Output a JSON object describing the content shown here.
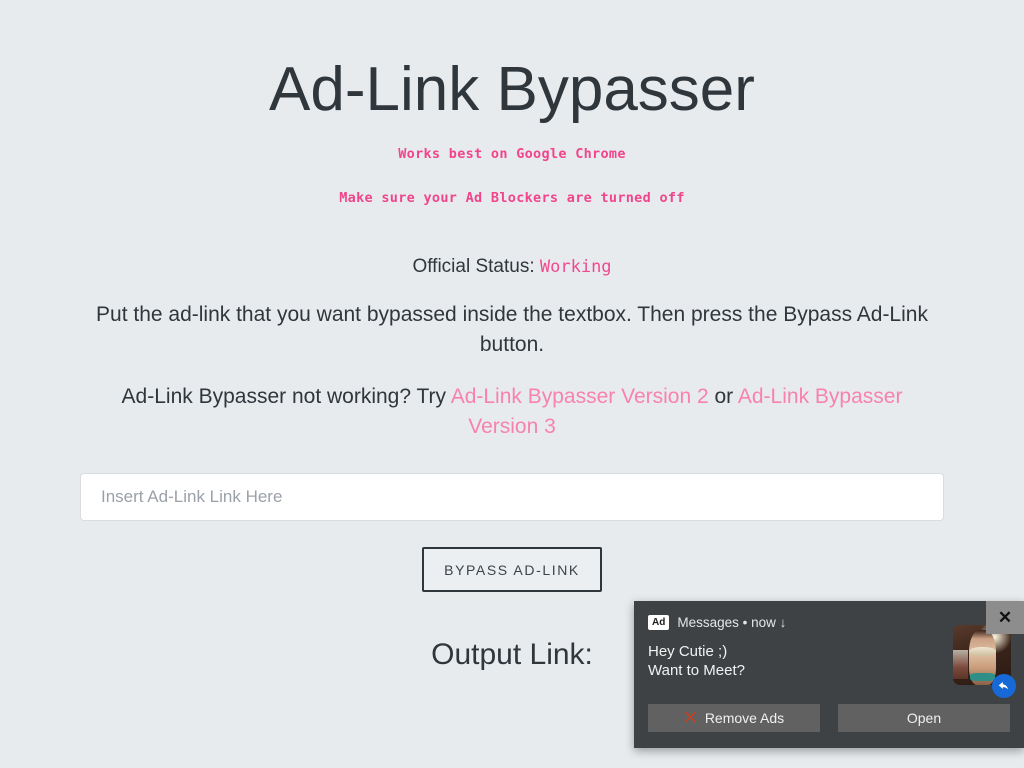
{
  "page": {
    "background_color": "#e8ebee",
    "title": "Ad-Link Bypasser",
    "notes": {
      "chrome": "Works best on Google Chrome",
      "adblock": "Make sure your Ad Blockers are turned off"
    },
    "status": {
      "label": "Official Status:",
      "value": "Working",
      "value_color": "#ef4a90"
    },
    "instructions": "Put the ad-link that you want bypassed inside the textbox. Then press the Bypass Ad-Link button.",
    "fallback": {
      "prefix": "Ad-Link Bypasser not working? Try ",
      "link_v2": "Ad-Link Bypasser Version 2",
      "separator": " or ",
      "link_v3": "Ad-Link Bypasser Version 3",
      "link_color": "#f783ac"
    },
    "input": {
      "placeholder": "Insert Ad-Link Link Here",
      "value": ""
    },
    "bypass_button": "BYPASS AD-LINK",
    "output_heading": "Output Link:"
  },
  "ad": {
    "badge": "Ad",
    "meta": "Messages • now ↓",
    "message_line_1": "Hey Cutie ;)",
    "message_line_2": "Want to Meet?",
    "close_label": "✕",
    "remove_ads_label": "Remove Ads",
    "open_label": "Open",
    "remove_icon": "red-x-icon",
    "reply_icon": "reply-arrow-icon",
    "panel_color": "#3e4245",
    "button_color": "#616161",
    "reply_badge_color": "#1769d8"
  }
}
